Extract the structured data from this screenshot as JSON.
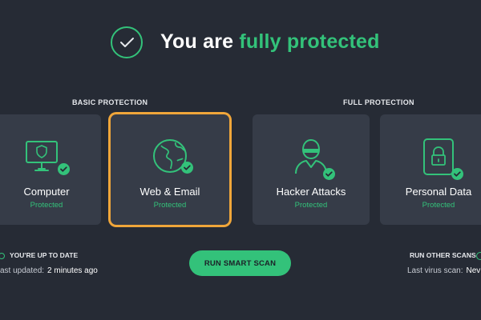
{
  "header": {
    "title_prefix": "You are ",
    "title_accent": "fully protected"
  },
  "sections": {
    "basic": "BASIC PROTECTION",
    "full": "FULL PROTECTION"
  },
  "cards": [
    {
      "title": "Computer",
      "status": "Protected",
      "icon": "monitor-shield-icon"
    },
    {
      "title": "Web & Email",
      "status": "Protected",
      "icon": "globe-icon",
      "selected": true
    },
    {
      "title": "Hacker Attacks",
      "status": "Protected",
      "icon": "hacker-icon"
    },
    {
      "title": "Personal Data",
      "status": "Protected",
      "icon": "lock-device-icon"
    }
  ],
  "footer": {
    "uptodate": "YOU'RE UP TO DATE",
    "last_updated_label": "ast updated:",
    "last_updated_value": "2 minutes ago",
    "scan_button": "RUN SMART SCAN",
    "other_scans": "RUN OTHER SCANS",
    "last_virus_label": "Last virus scan:",
    "last_virus_value": "Nev"
  },
  "colors": {
    "background": "#262b35",
    "card": "#363c48",
    "accent": "#33c27a",
    "selection": "#f0a63a"
  }
}
